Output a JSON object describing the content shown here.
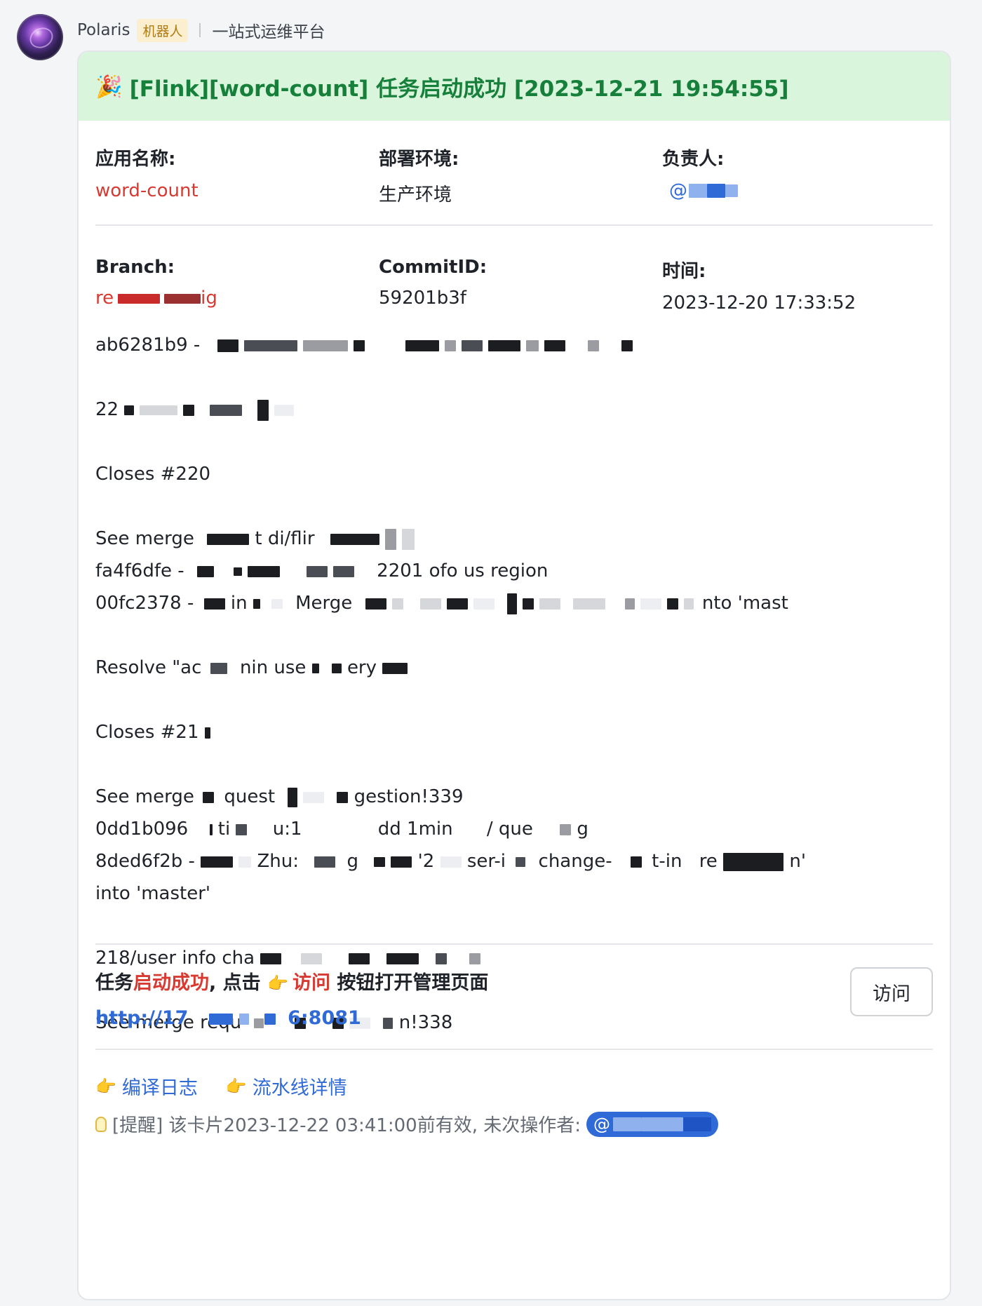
{
  "sender": {
    "name": "Polaris",
    "badge": "机器人",
    "subtitle": "一站式运维平台"
  },
  "card": {
    "title_emoji": "🎉",
    "title": "[Flink][word-count] 任务启动成功 [2023-12-21 19:54:55]",
    "app": {
      "label": "应用名称:",
      "value": "word-count"
    },
    "env": {
      "label": "部署环境:",
      "value": "生产环境"
    },
    "owner": {
      "label": "负责人:",
      "value": "@"
    },
    "branch": {
      "label": "Branch:",
      "value_prefix": "re",
      "value_suffix": "ig"
    },
    "commit": {
      "label": "CommitID:",
      "value": "59201b3f"
    },
    "time": {
      "label": "时间:",
      "value": "2023-12-20 17:33:52"
    },
    "commit_lines": [
      "ab6281b9 -",
      "22",
      "",
      "Closes #220",
      "",
      "See merge",
      "fa4f6dfe -",
      "00fc2378 -",
      "",
      "Resolve \"ac",
      "",
      "Closes #21",
      "",
      "See merge",
      "0dd1b096",
      "8ded6f2b -",
      "into 'master'",
      "",
      "218/user info cha",
      "",
      "See merge requ"
    ],
    "line_fragments": {
      "l6a": "t di/flir",
      "l7a": "2201 ofo us region",
      "l8a": "in",
      "l8b": "Merge",
      "l8c": "nto 'mast",
      "l10a": "nin use",
      "l10b": "ery",
      "l14a": "quest",
      "l14b": "gestion!339",
      "l15a": "ti",
      "l15b": "u:1",
      "l15c": "dd 1min",
      "l15d": "/ que",
      "l15e": "g",
      "l16a": "Zhu:",
      "l16b": "g",
      "l16c": "'2",
      "l16d": "ser-i",
      "l16e": "change-",
      "l16f": "t-in",
      "l16g": "re",
      "l16h": "n'",
      "l21a": "n!338"
    },
    "action": {
      "text_a": "任务",
      "text_red1": "启动成功",
      "text_b": ", 点击 ",
      "hand": "👉",
      "text_red2": "访问",
      "text_c": " 按钮打开管理页面",
      "url_prefix": "http://17",
      "url_suffix": "6:8081",
      "button": "访问"
    },
    "links": [
      {
        "label": "编译日志"
      },
      {
        "label": "流水线详情"
      }
    ],
    "reminder": "[提醒] 该卡片2023-12-22 03:41:00前有效, 未次操作者:",
    "reminder_mention": "@"
  },
  "colors": {
    "title_bg": "#d9f5dc",
    "title_text": "#16803b",
    "accent_red": "#d83931",
    "link_blue": "#2f6ad6"
  }
}
